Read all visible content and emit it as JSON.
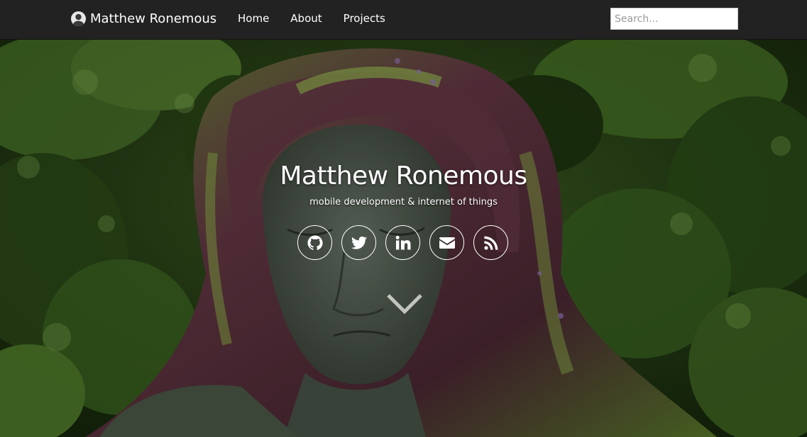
{
  "navbar": {
    "brand_name": "Matthew Ronemous",
    "brand_icon": "user-avatar",
    "links": [
      {
        "label": "Home"
      },
      {
        "label": "About"
      },
      {
        "label": "Projects"
      }
    ],
    "search_placeholder": "Search..."
  },
  "hero": {
    "background": "earth-goddess-topiary-photo",
    "title": "Matthew Ronemous",
    "subtitle": "mobile development & internet of things",
    "social": [
      {
        "icon": "github-icon"
      },
      {
        "icon": "twitter-icon"
      },
      {
        "icon": "linkedin-icon"
      },
      {
        "icon": "envelope-icon"
      },
      {
        "icon": "rss-icon"
      }
    ],
    "scroll_icon": "chevron-down-icon"
  },
  "colors": {
    "navbar_bg": "#222222",
    "text": "#ffffff",
    "foliage_dark": "#1f3a12",
    "foliage_light": "#4e7a2a",
    "statue_face": "#5e6a5e",
    "hair_purple": "#6a3a48"
  }
}
